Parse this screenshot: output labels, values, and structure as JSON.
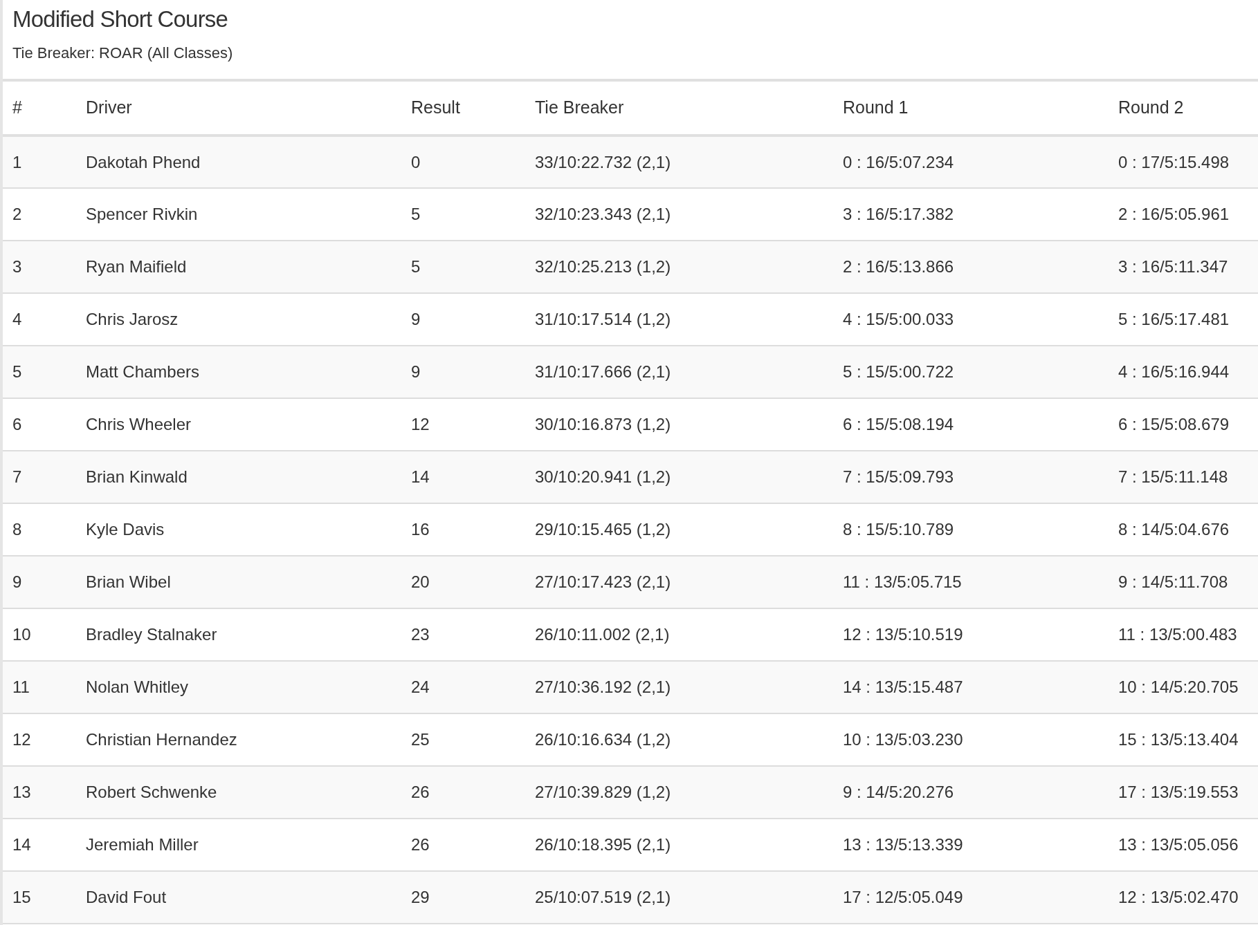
{
  "title": "Modified Short Course",
  "subtitle": "Tie Breaker: ROAR (All Classes)",
  "table": {
    "columns": [
      "#",
      "Driver",
      "Result",
      "Tie Breaker",
      "Round 1",
      "Round 2"
    ],
    "rows": [
      [
        "1",
        "Dakotah Phend",
        "0",
        "33/10:22.732 (2,1)",
        "0 : 16/5:07.234",
        "0 : 17/5:15.498"
      ],
      [
        "2",
        "Spencer Rivkin",
        "5",
        "32/10:23.343 (2,1)",
        "3 : 16/5:17.382",
        "2 : 16/5:05.961"
      ],
      [
        "3",
        "Ryan Maifield",
        "5",
        "32/10:25.213 (1,2)",
        "2 : 16/5:13.866",
        "3 : 16/5:11.347"
      ],
      [
        "4",
        "Chris Jarosz",
        "9",
        "31/10:17.514 (1,2)",
        "4 : 15/5:00.033",
        "5 : 16/5:17.481"
      ],
      [
        "5",
        "Matt Chambers",
        "9",
        "31/10:17.666 (2,1)",
        "5 : 15/5:00.722",
        "4 : 16/5:16.944"
      ],
      [
        "6",
        "Chris Wheeler",
        "12",
        "30/10:16.873 (1,2)",
        "6 : 15/5:08.194",
        "6 : 15/5:08.679"
      ],
      [
        "7",
        "Brian Kinwald",
        "14",
        "30/10:20.941 (1,2)",
        "7 : 15/5:09.793",
        "7 : 15/5:11.148"
      ],
      [
        "8",
        "Kyle Davis",
        "16",
        "29/10:15.465 (1,2)",
        "8 : 15/5:10.789",
        "8 : 14/5:04.676"
      ],
      [
        "9",
        "Brian Wibel",
        "20",
        "27/10:17.423 (2,1)",
        "11 : 13/5:05.715",
        "9 : 14/5:11.708"
      ],
      [
        "10",
        "Bradley Stalnaker",
        "23",
        "26/10:11.002 (2,1)",
        "12 : 13/5:10.519",
        "11 : 13/5:00.483"
      ],
      [
        "11",
        "Nolan Whitley",
        "24",
        "27/10:36.192 (2,1)",
        "14 : 13/5:15.487",
        "10 : 14/5:20.705"
      ],
      [
        "12",
        "Christian Hernandez",
        "25",
        "26/10:16.634 (1,2)",
        "10 : 13/5:03.230",
        "15 : 13/5:13.404"
      ],
      [
        "13",
        "Robert Schwenke",
        "26",
        "27/10:39.829 (1,2)",
        "9 : 14/5:20.276",
        "17 : 13/5:19.553"
      ],
      [
        "14",
        "Jeremiah Miller",
        "26",
        "26/10:18.395 (2,1)",
        "13 : 13/5:13.339",
        "13 : 13/5:05.056"
      ],
      [
        "15",
        "David Fout",
        "29",
        "25/10:07.519 (2,1)",
        "17 : 12/5:05.049",
        "12 : 13/5:02.470"
      ]
    ]
  }
}
